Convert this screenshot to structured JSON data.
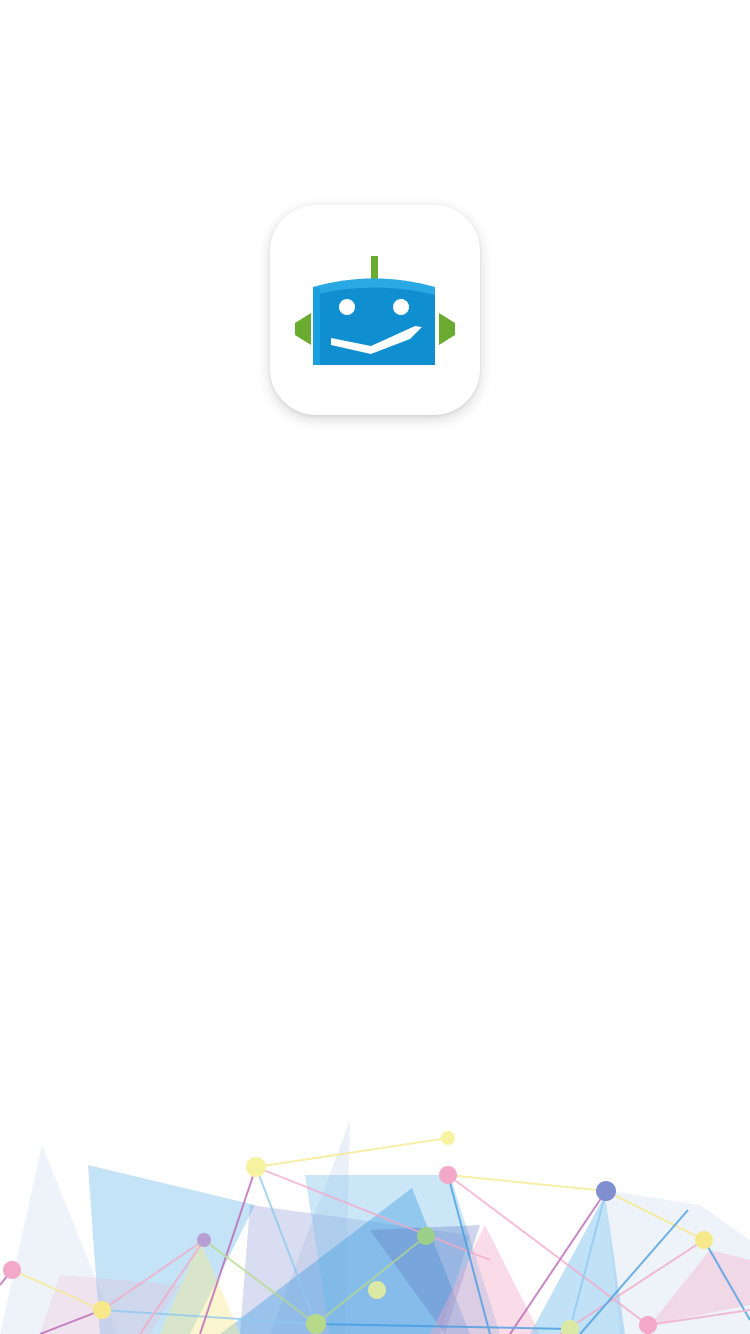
{
  "screen": {
    "type": "splash",
    "background": "#ffffff"
  },
  "app_icon": {
    "icon_name": "robot-face-icon",
    "colors": {
      "head": "#0f8fcf",
      "head_highlight": "#2aa8e3",
      "ears_and_antenna": "#6aaa2f",
      "features": "#ffffff"
    }
  },
  "decoration": {
    "name": "polygon-network-art",
    "colors": [
      "#8cc8ee",
      "#c7d3ea",
      "#f3a8c7",
      "#f7e98a",
      "#b7d98a",
      "#7f8fcf"
    ]
  }
}
